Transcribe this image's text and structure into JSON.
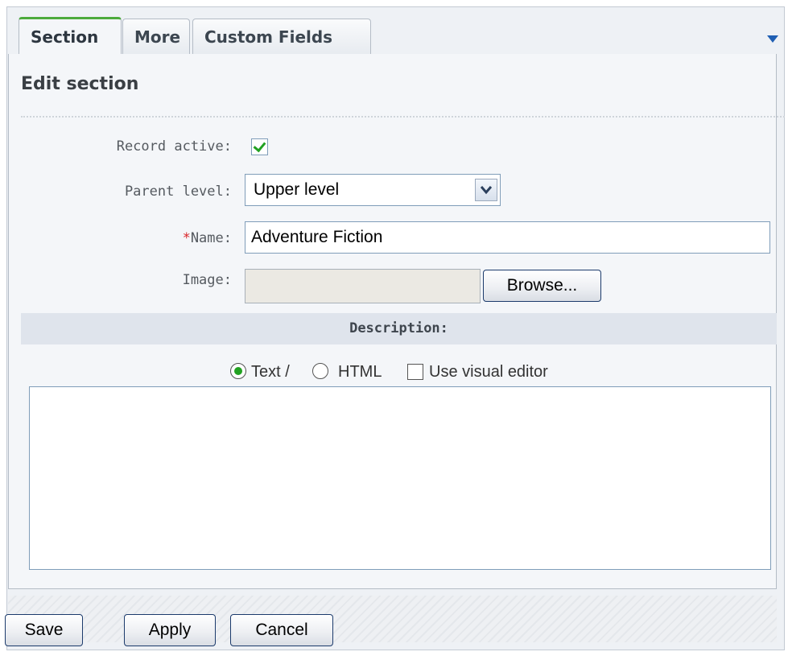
{
  "tabs": [
    {
      "label": "Section",
      "active": true
    },
    {
      "label": "More",
      "active": false
    },
    {
      "label": "Custom Fields",
      "active": false
    }
  ],
  "title": "Edit section",
  "fields": {
    "record_active": {
      "label": "Record active:",
      "checked": true
    },
    "parent_level": {
      "label": "Parent level:",
      "value": "Upper level"
    },
    "name": {
      "required_mark": "*",
      "label": "Name:",
      "value": "Adventure Fiction"
    },
    "image": {
      "label": "Image:",
      "browse_label": "Browse..."
    }
  },
  "description": {
    "header": "Description:",
    "options": {
      "text": "Text /",
      "html": "HTML",
      "visual_editor": "Use visual editor"
    },
    "selected": "text",
    "visual_editor_checked": false,
    "content": ""
  },
  "buttons": {
    "save": "Save",
    "apply": "Apply",
    "cancel": "Cancel"
  },
  "colors": {
    "active_tab_accent": "#4caa3c",
    "check_green": "#21a121",
    "required_red": "#d9262a",
    "dropdown_blue": "#1f5fb3"
  }
}
